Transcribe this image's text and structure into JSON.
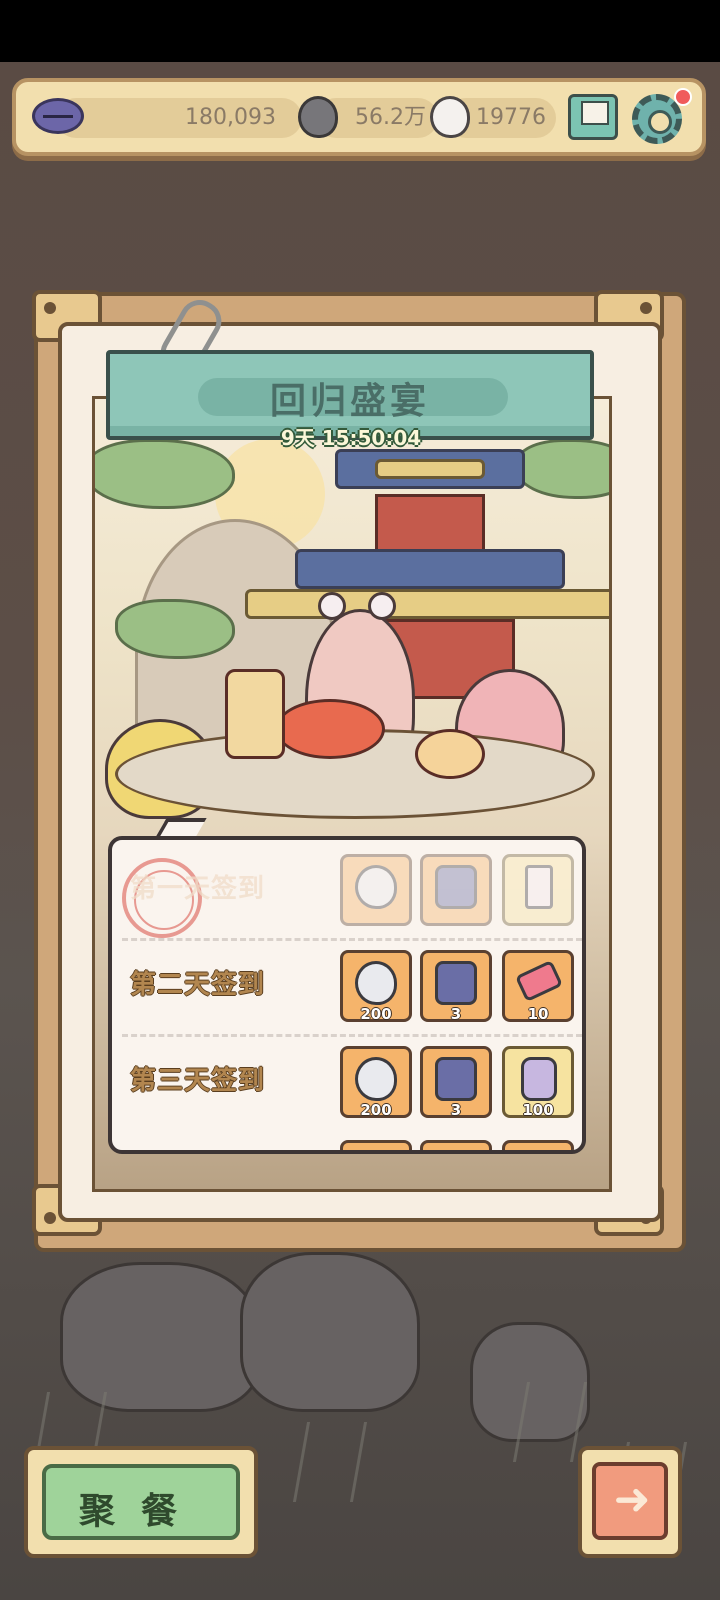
{
  "resources": {
    "lips_value": "180,093",
    "gray_drop_value": "56.2万",
    "white_drop_value": "19776",
    "icons": [
      "lips-icon",
      "gray-drop-icon",
      "white-drop-icon",
      "mail-icon",
      "settings-gear-icon"
    ]
  },
  "event": {
    "title": "回归盛宴",
    "timer": "9天 15:50:04"
  },
  "signin": {
    "rows": [
      {
        "label": "第一天签到",
        "claimed": true,
        "rewards": [
          {
            "icon": "white-drop-icon",
            "count": ""
          },
          {
            "icon": "treasure-chest-icon",
            "count": ""
          },
          {
            "icon": "hourglass-icon",
            "count": ""
          }
        ]
      },
      {
        "label": "第二天签到",
        "claimed": false,
        "rewards": [
          {
            "icon": "white-drop-icon",
            "count": "200"
          },
          {
            "icon": "treasure-chest-icon",
            "count": "3"
          },
          {
            "icon": "ticket-icon",
            "count": "10"
          }
        ]
      },
      {
        "label": "第三天签到",
        "claimed": false,
        "rewards": [
          {
            "icon": "white-drop-icon",
            "count": "200"
          },
          {
            "icon": "treasure-chest-icon",
            "count": "3"
          },
          {
            "icon": "jar-icon",
            "count": "100"
          }
        ]
      }
    ]
  },
  "buttons": {
    "gather_label": "聚餐",
    "next_icon": "arrow-right-icon"
  },
  "colors": {
    "banner": "#8ec6b8",
    "reward_tile": "#f5b46b",
    "gather_button": "#9fd39a",
    "next_button": "#f19b7e"
  }
}
